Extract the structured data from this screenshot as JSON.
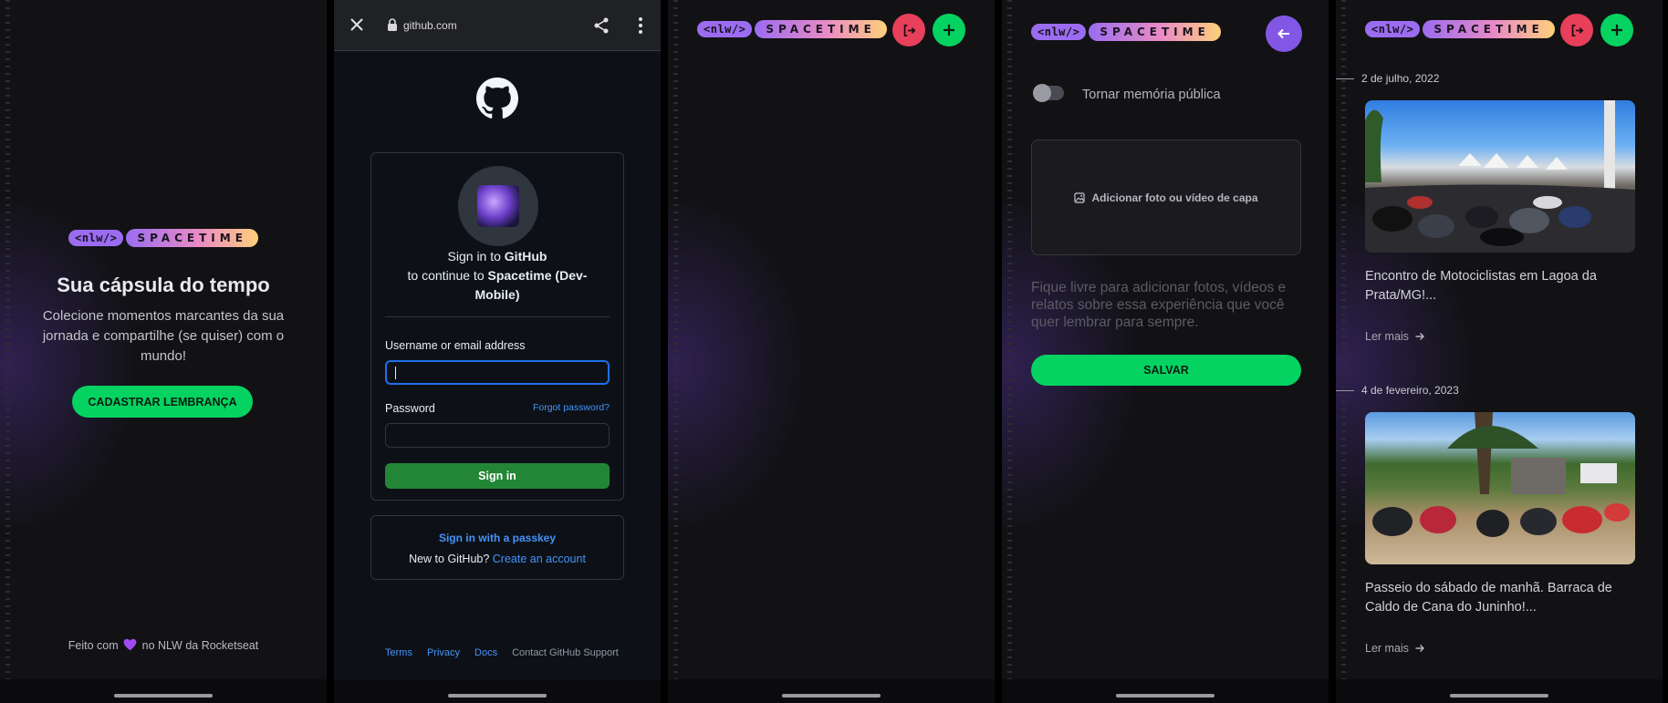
{
  "brand": {
    "tag": "<nlw/>",
    "word": "SPACETIME"
  },
  "colors": {
    "accent_green": "#04d361",
    "accent_red": "#e83f5b",
    "accent_purple": "#8257e5",
    "github_green": "#238636",
    "link_blue": "#4493f8"
  },
  "screen1": {
    "title": "Sua cápsula do tempo",
    "description": "Colecione momentos marcantes da sua jornada e compartilhe (se quiser) com o mundo!",
    "cta": "CADASTRAR LEMBRANÇA",
    "footer_before": "Feito com",
    "footer_icon": "purple-heart-icon",
    "footer_after": "no NLW da Rocketseat"
  },
  "screen2": {
    "url": "github.com",
    "signin_prefix": "Sign in to",
    "signin_brand": "GitHub",
    "continue_prefix": "to continue to",
    "app_name": "Spacetime (Dev-Mobile)",
    "username_label": "Username or email address",
    "password_label": "Password",
    "forgot": "Forgot password?",
    "signin_button": "Sign in",
    "passkey": "Sign in with a passkey",
    "new_prefix": "New to GitHub?",
    "create_account": "Create an account",
    "footer_links": [
      "Terms",
      "Privacy",
      "Docs",
      "Contact GitHub Support"
    ]
  },
  "screen4": {
    "toggle_label": "Tornar memória pública",
    "toggle_on": false,
    "media_button": "Adicionar foto ou vídeo de capa",
    "placeholder": "Fique livre para adicionar fotos, vídeos e relatos sobre essa experiência que você quer lembrar para sempre.",
    "save": "SALVAR"
  },
  "screen5": {
    "memories": [
      {
        "date": "2 de julho, 2022",
        "excerpt": "Encontro de Motociclistas em Lagoa da Prata/MG!...",
        "link": "Ler mais"
      },
      {
        "date": "4 de fevereiro, 2023",
        "excerpt": "Passeio do sábado de manhã. Barraca de Caldo de Cana do Juninho!...",
        "link": "Ler mais"
      }
    ]
  }
}
